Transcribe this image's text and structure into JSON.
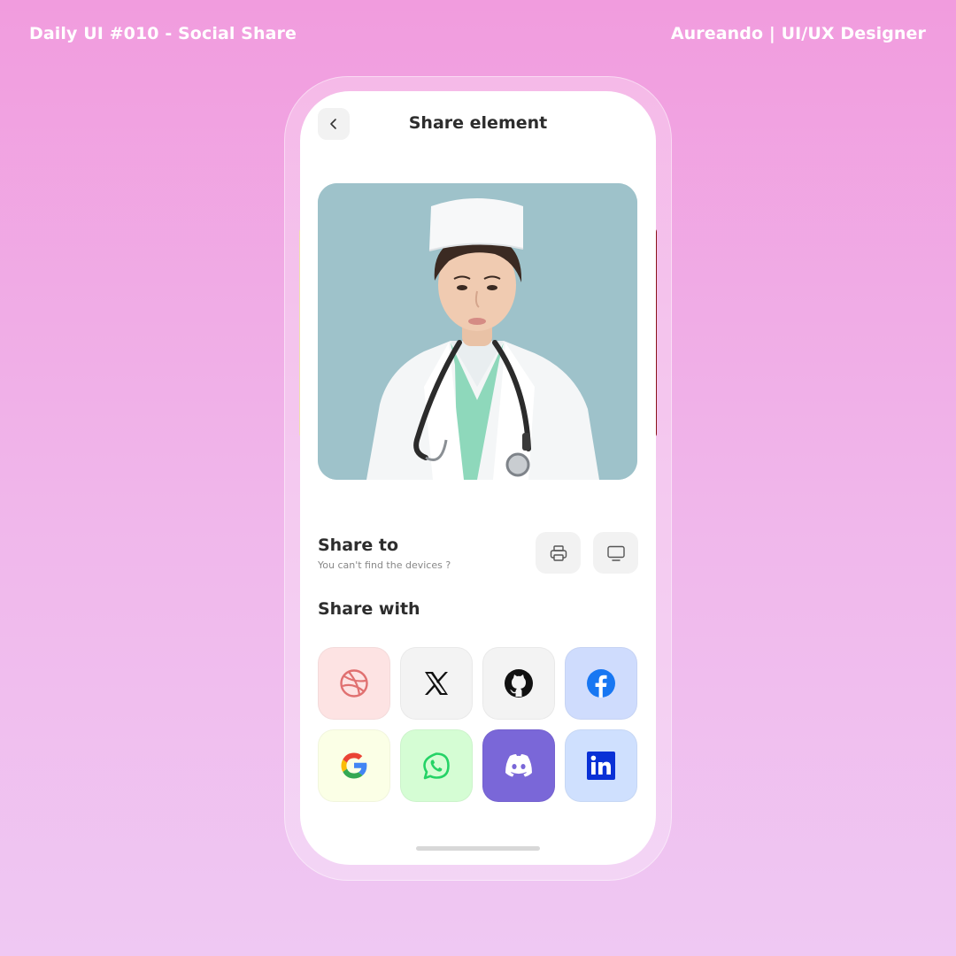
{
  "header": {
    "left_title": "Daily UI #010 - Social Share",
    "right_title": "Aureando | UI/UX Designer"
  },
  "screen": {
    "title": "Share element",
    "back_icon": "chevron-left-icon",
    "photo_icon": "doctor-child-photo",
    "share_to": {
      "title": "Share to",
      "subtitle": "You can't find the devices ?",
      "devices": [
        "printer-icon",
        "monitor-icon"
      ]
    },
    "share_with": {
      "title": "Share with",
      "apps": [
        {
          "icon": "dribbble-icon",
          "color": "#e07070",
          "bg": "#fde3e3"
        },
        {
          "icon": "x-icon",
          "color": "#111111",
          "bg": "#f3f3f3"
        },
        {
          "icon": "github-icon",
          "color": "#111111",
          "bg": "#f3f3f3"
        },
        {
          "icon": "facebook-icon",
          "color": "#1877f2",
          "bg": "#cfdcfd"
        },
        {
          "icon": "google-icon",
          "color": "#4285f4",
          "bg": "#fbffe6"
        },
        {
          "icon": "whatsapp-icon",
          "color": "#25d366",
          "bg": "#d5fdd4"
        },
        {
          "icon": "discord-icon",
          "color": "#ffffff",
          "bg": "#7a67d8"
        },
        {
          "icon": "linkedin-icon",
          "color": "#0a31d6",
          "bg": "#cfe0fe"
        }
      ]
    }
  },
  "colors": {
    "background_top": "#f19cde",
    "background_bottom": "#efc8f3",
    "card": "#ffffff",
    "text_dark": "#2d2d2d",
    "peek_left": "#ecd68c",
    "peek_right": "#8a1219"
  }
}
